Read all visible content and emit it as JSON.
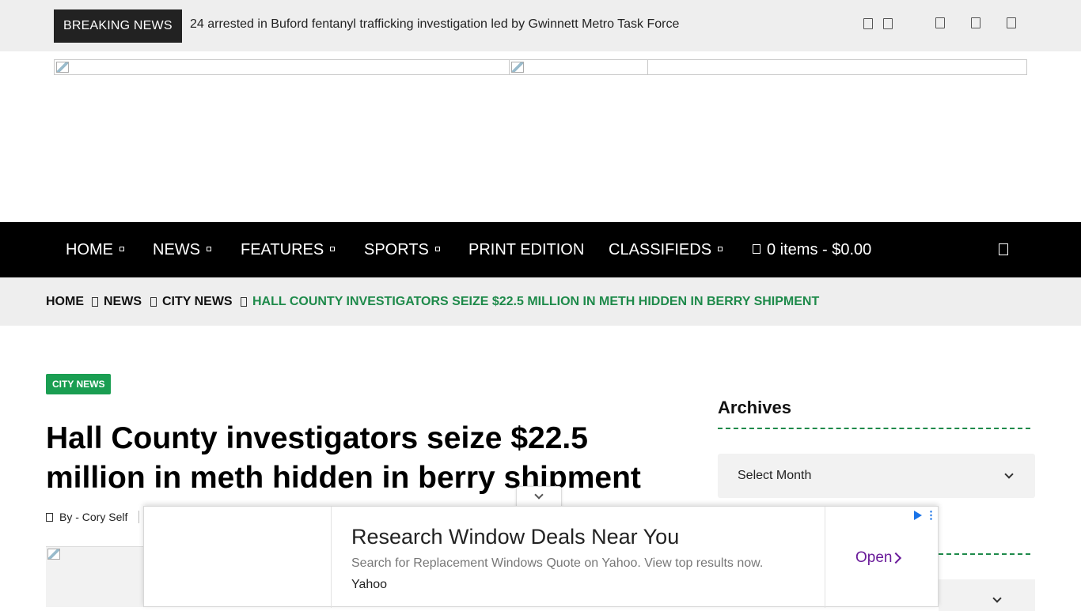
{
  "topbar": {
    "breaking_label": "BREAKING NEWS",
    "breaking_headline": "24 arrested in Buford fentanyl trafficking investigation led by Gwinnett Metro Task Force",
    "icons": [
      "social-icon-1",
      "social-icon-2",
      "social-icon-3",
      "social-icon-4",
      "social-icon-5"
    ]
  },
  "nav": {
    "items": [
      {
        "label": "HOME",
        "has_dropdown": true
      },
      {
        "label": "NEWS",
        "has_dropdown": true
      },
      {
        "label": "FEATURES",
        "has_dropdown": true
      },
      {
        "label": "SPORTS",
        "has_dropdown": true
      },
      {
        "label": "PRINT EDITION",
        "has_dropdown": false
      },
      {
        "label": "CLASSIFIEDS",
        "has_dropdown": true
      }
    ],
    "cart_label": "0 items - $0.00"
  },
  "breadcrumb": {
    "items": [
      "HOME",
      "NEWS",
      "CITY NEWS"
    ],
    "current": "HALL COUNTY INVESTIGATORS SEIZE $22.5 MILLION IN METH HIDDEN IN BERRY SHIPMENT"
  },
  "article": {
    "category": "CITY NEWS",
    "title": "Hall County investigators seize $22.5 million in meth hidden in berry shipment",
    "byline": "By - Cory Self"
  },
  "sidebar": {
    "archives_heading": "Archives",
    "select_value": "Select Month"
  },
  "ad": {
    "title": "Research Window Deals Near You",
    "description": "Search for Replacement Windows Quote on Yahoo. View top results now.",
    "source": "Yahoo",
    "cta": "Open"
  },
  "colors": {
    "accent_green": "#1a9e52",
    "breadcrumb_current": "#1e8a4a",
    "nav_bg": "#000000",
    "ad_cta": "#6a1b9a"
  }
}
